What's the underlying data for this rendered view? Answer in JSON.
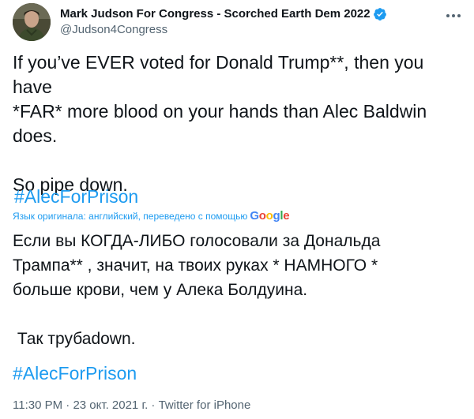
{
  "author": {
    "name": "Mark Judson For Congress - Scorched Earth Dem 2022",
    "handle": "@Judson4Congress",
    "verified_icon": "verified-badge-icon",
    "accent": "#1d9bf0"
  },
  "tweet": {
    "original_text": "If you’ve EVER voted for Donald Trump**, then you have\n*FAR* more blood on your hands than Alec Baldwin\ndoes.\n\nSo pipe down.",
    "hashtag": "#AlecForPrison",
    "translation_note": "Язык оригинала: английский, переведено с помощью",
    "translation_provider": "Google",
    "translated_text": "Если вы КОГДА-ЛИБО голосовали за Дональда\nТрампа** , значит, на твоих руках * НАМНОГО *\nбольше крови, чем у Алека Болдуина.\n\n Так трубаdown.",
    "translated_hashtag": "#AlecForPrison"
  },
  "meta": {
    "time": "11:30 PM",
    "separator1": " · ",
    "date": "23 окт. 2021 г.",
    "separator2": " · ",
    "source": "Twitter for iPhone"
  }
}
